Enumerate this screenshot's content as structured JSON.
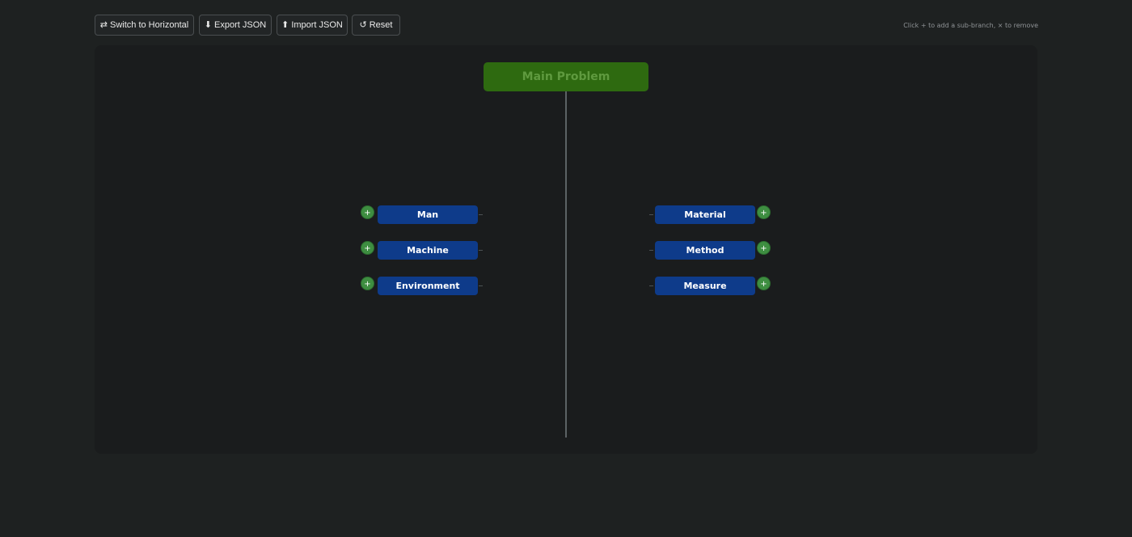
{
  "toolbar": {
    "switch_icon": "⇄",
    "switch_label": "Switch to Horizontal",
    "export_icon": "⬇",
    "export_label": "Export JSON",
    "import_icon": "⬆",
    "import_label": "Import JSON",
    "reset_icon": "↺",
    "reset_label": "Reset",
    "hint": "Click + to add a sub-branch, × to remove"
  },
  "diagram": {
    "main_problem": "Main Problem",
    "add_symbol": "+",
    "left_categories": [
      {
        "label": "Man"
      },
      {
        "label": "Machine"
      },
      {
        "label": "Environment"
      }
    ],
    "right_categories": [
      {
        "label": "Material"
      },
      {
        "label": "Method"
      },
      {
        "label": "Measure"
      }
    ]
  },
  "colors": {
    "background": "#1e2121",
    "canvas": "#1a1c1d",
    "main_problem_bg": "#2e6a10",
    "main_problem_text": "#5f9a3f",
    "category_bg": "#0e3b8a",
    "add_button": "#3e8e41",
    "spine": "#5c6265"
  }
}
